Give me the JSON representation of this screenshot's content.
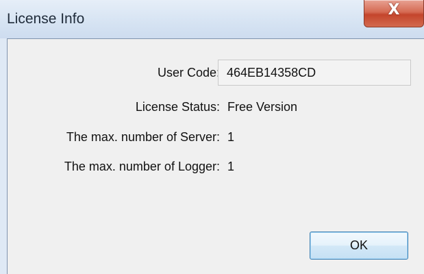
{
  "window": {
    "title": "License Info",
    "close_glyph": "X"
  },
  "fields": {
    "user_code_label": "User Code:",
    "user_code_value": "464EB14358CD",
    "license_status_label": "License Status:",
    "license_status_value": "Free Version",
    "max_server_label": "The max. number of Server:",
    "max_server_value": "1",
    "max_logger_label": "The max. number of Logger:",
    "max_logger_value": "1"
  },
  "buttons": {
    "ok_label": "OK"
  },
  "colors": {
    "client_bg": "#f0f0f0",
    "titlebar_bg": "#d7e4f3",
    "close_red": "#c4452c",
    "ok_border": "#3c7fb1"
  }
}
